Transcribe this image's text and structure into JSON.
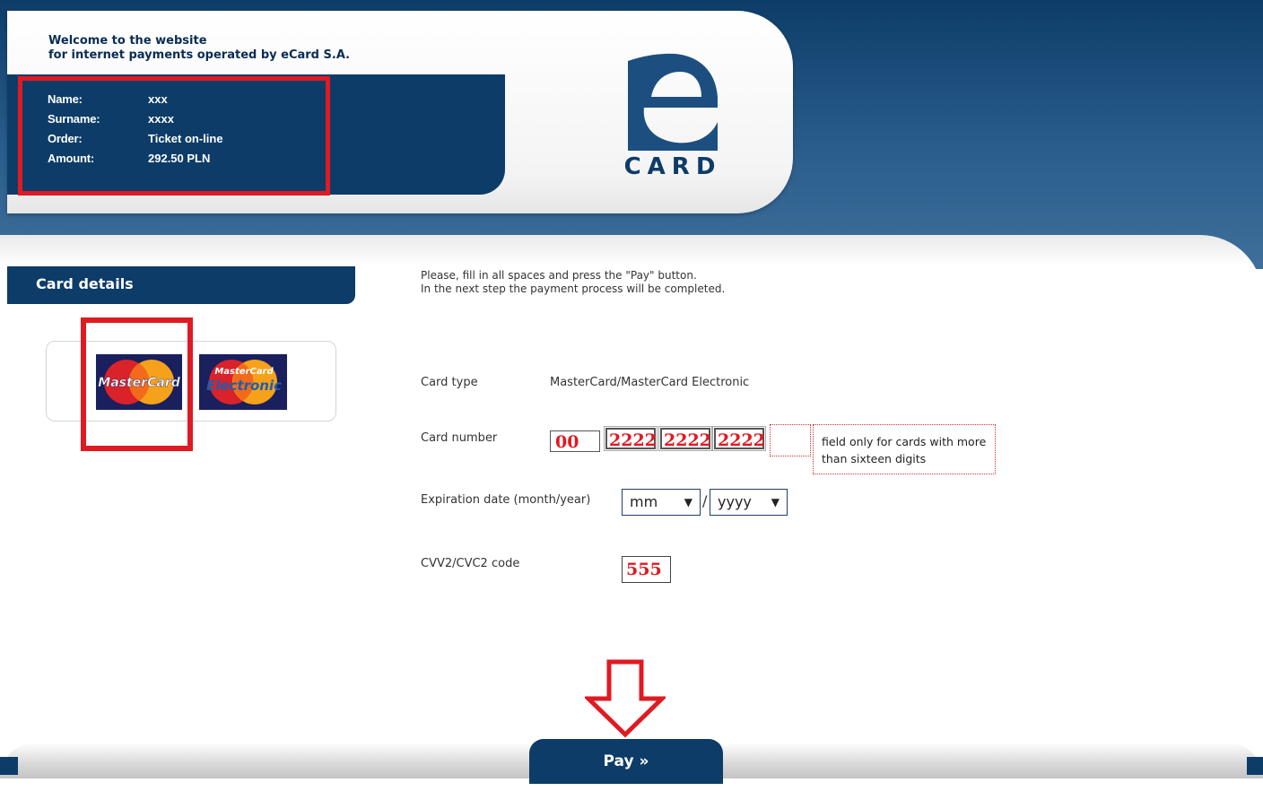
{
  "header": {
    "welcome_line1": "Welcome to the website",
    "welcome_line2": "for internet payments operated by eCard S.A.",
    "info": {
      "name_label": "Name:",
      "name_value": "xxx",
      "surname_label": "Surname:",
      "surname_value": "xxxx",
      "order_label": "Order:",
      "order_value": "Ticket on-line",
      "amount_label": "Amount:",
      "amount_value": "292.50 PLN"
    },
    "logo_text": "CARD"
  },
  "sidebar": {
    "title": "Card details",
    "card_logos": [
      {
        "name": "mastercard-logo",
        "text": "MasterCard"
      },
      {
        "name": "mastercard-electronic-logo",
        "text_top": "MasterCard",
        "text_bottom": "Electronic"
      }
    ]
  },
  "form": {
    "instructions_line1": "Please, fill in all spaces and press the \"Pay\" button.",
    "instructions_line2": "In the next step the payment process will be completed.",
    "card_type_label": "Card type",
    "card_type_value": "MasterCard/MasterCard Electronic",
    "card_number_label": "Card number",
    "card_number_parts": [
      "00",
      "2222",
      "2222",
      "2222",
      ""
    ],
    "extra_field_note": "field only for cards with more than sixteen digits",
    "expiration_label": "Expiration date (month/year)",
    "month_selected": "mm",
    "year_selected": "yyyy",
    "separator": "/",
    "cvv_label": "CVV2/CVC2 code",
    "cvv_value": "555",
    "pay_button": "Pay »"
  },
  "colors": {
    "brand_navy": "#0d3c68",
    "highlight_red": "#e01a22",
    "input_text_red": "#e01a22"
  }
}
